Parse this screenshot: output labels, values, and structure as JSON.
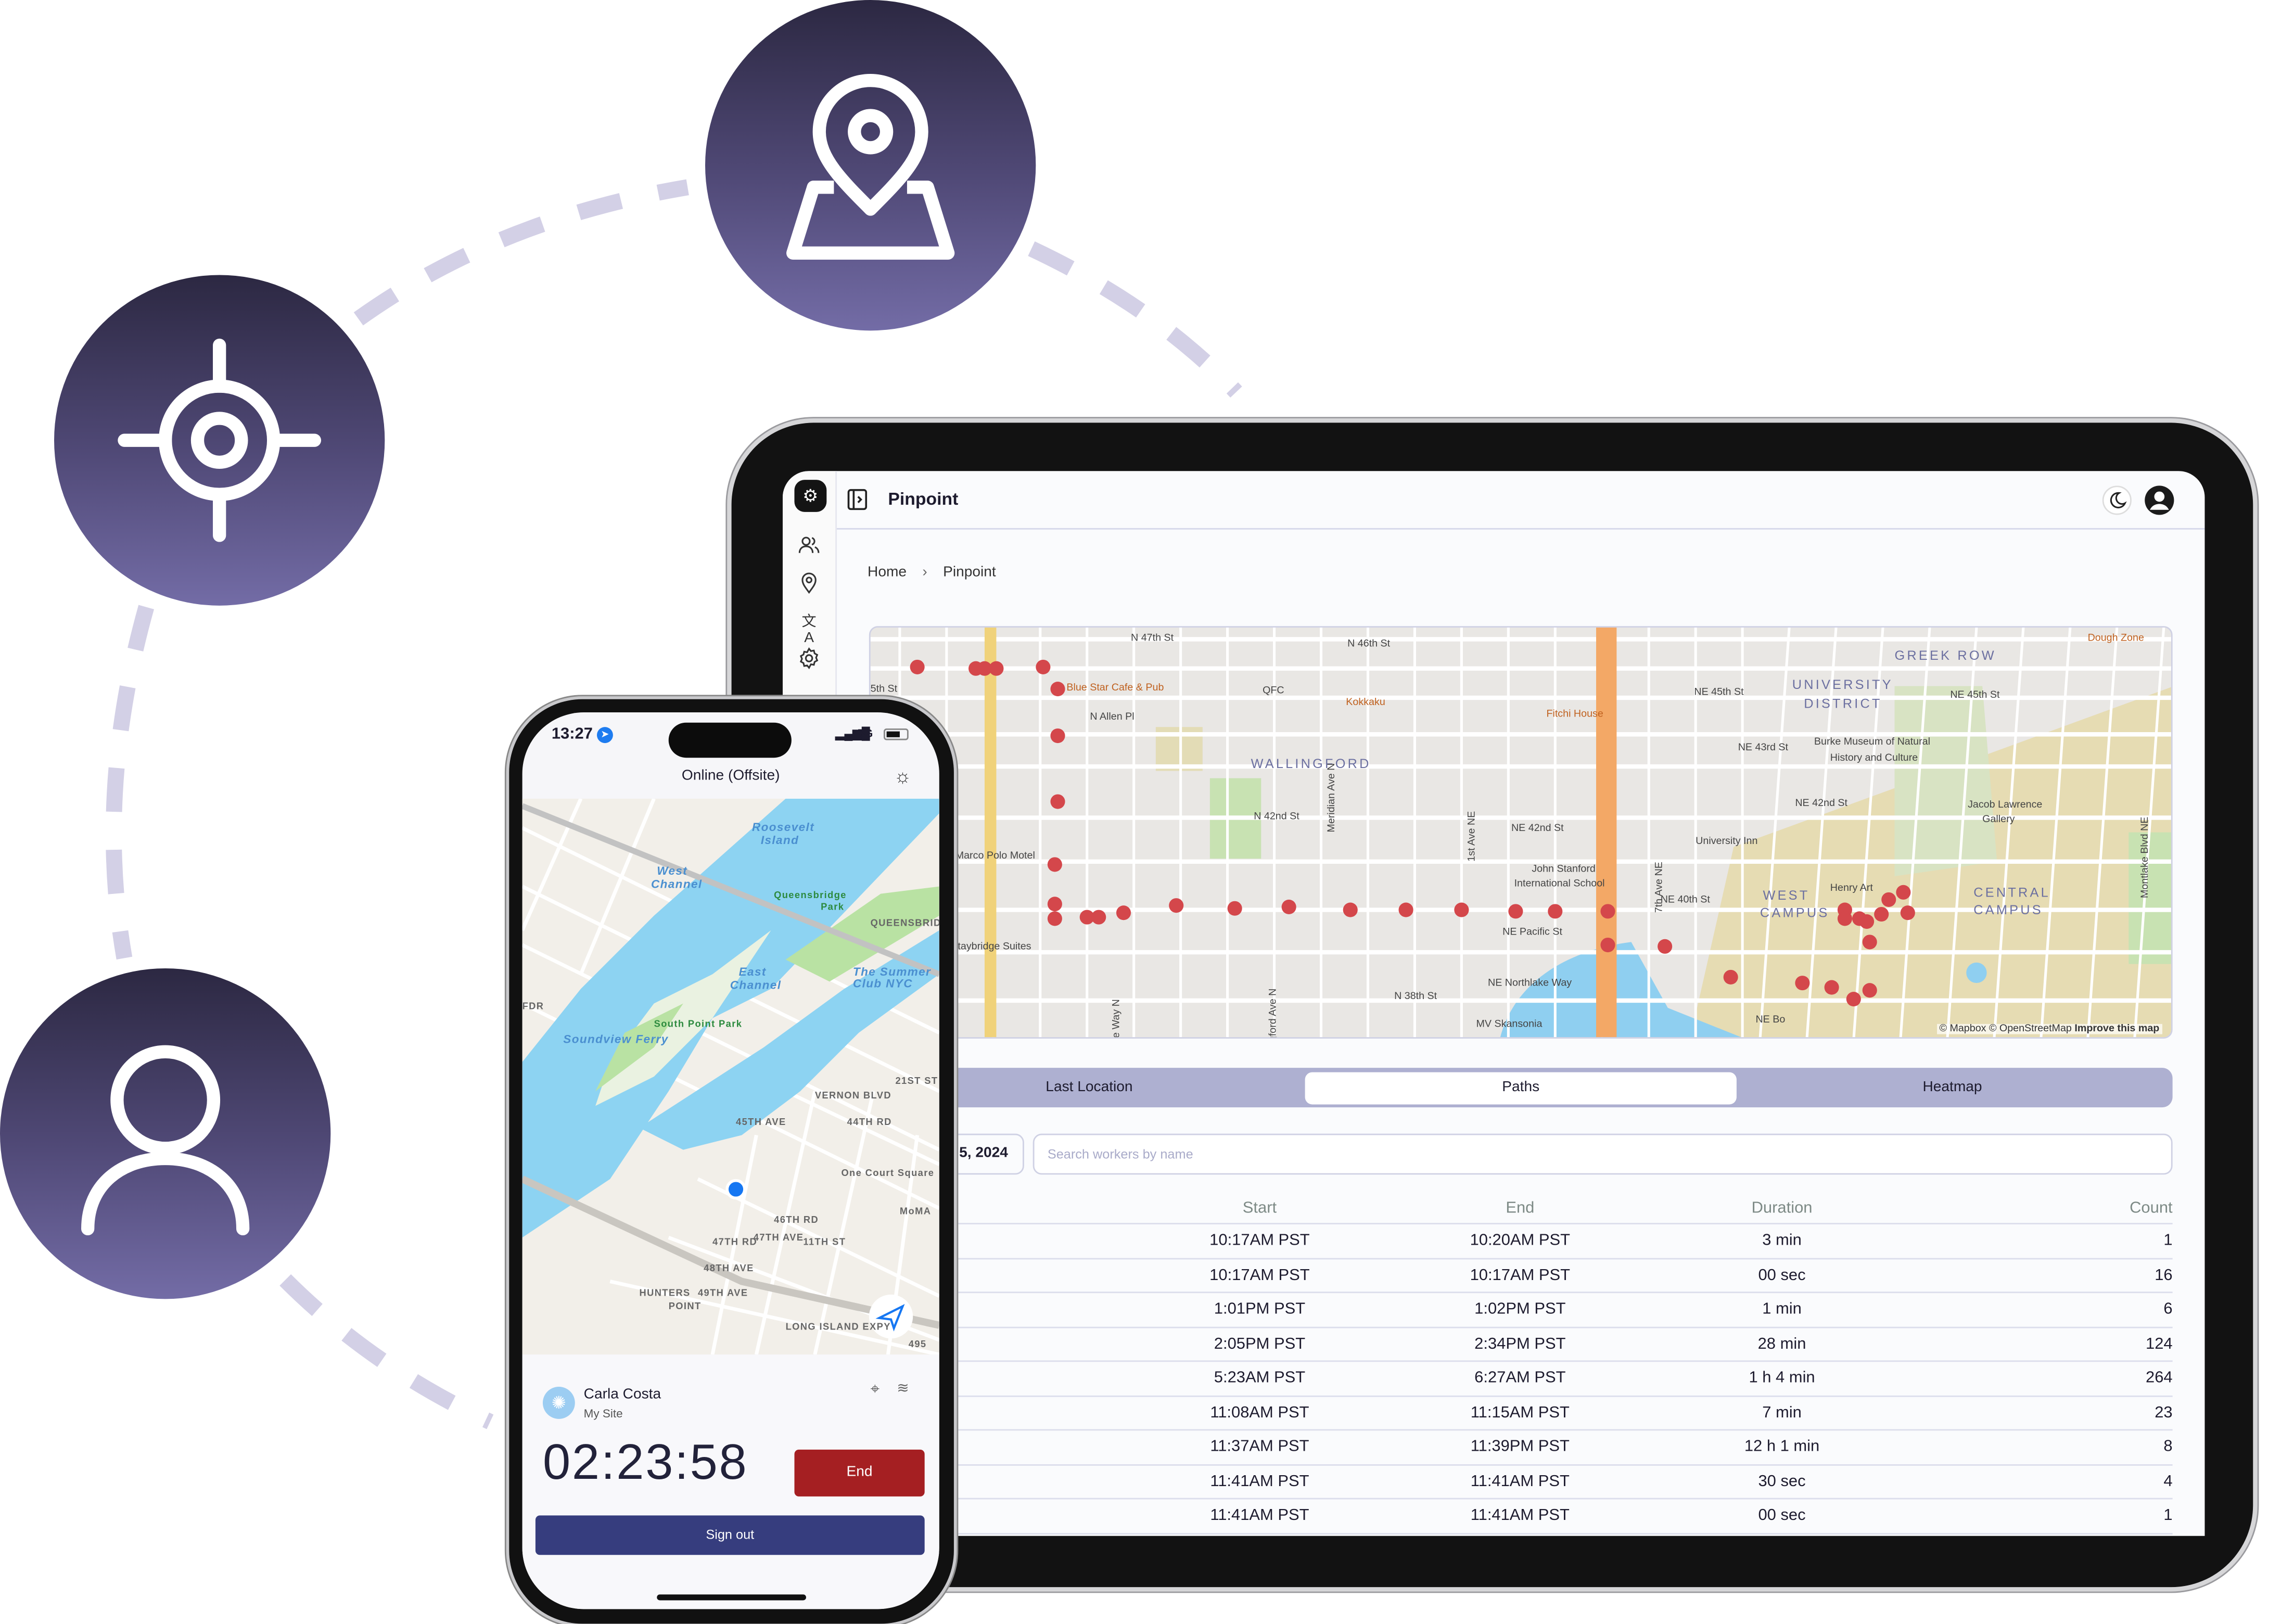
{
  "decor": {
    "circle_color_top": "#2c2842",
    "circle_color_bottom": "#736ca6",
    "dash_color": "#d3d0e6",
    "icons": [
      "map-pin-icon",
      "crosshair-icon",
      "user-icon"
    ]
  },
  "app": {
    "title": "Pinpoint",
    "breadcrumb": {
      "home": "Home",
      "separator": "›",
      "current": "Pinpoint"
    },
    "sidebar_icons": [
      "logo-icon",
      "users-icon",
      "location-icon",
      "translate-icon",
      "settings-icon"
    ],
    "header_icons": [
      "moon-icon",
      "account-icon"
    ],
    "map": {
      "labels": [
        "N 47th St",
        "N 46th St",
        "Blue Star Cafe & Pub",
        "QFC",
        "Kokkaku",
        "Fitchi House",
        "N Allen Pl",
        "WALLINGFORD",
        "N 42nd St",
        "NE 42nd St",
        "NE 45th St",
        "NE 45th St",
        "UNIVERSITY",
        "DISTRICT",
        "GREEK ROW",
        "Dough Zone",
        "NE 43rd St",
        "Burke Museum of Natural",
        "History and Culture",
        "NE 42nd St",
        "Jacob Lawrence",
        "Gallery",
        "University Inn",
        "John Stanford",
        "International School",
        "WEST",
        "CAMPUS",
        "CENTRAL",
        "CAMPUS",
        "Henry Art",
        "NE 40th St",
        "NE Pacific St",
        "NE Northlake Way",
        "N 38th St",
        "MV Skansonia",
        "Marco Polo Motel",
        "Staybridge Suites",
        "Meridian Ave N",
        "Wallingford Ave N",
        "Stone Way N",
        "1st Ave NE",
        "7th Ave NE",
        "Montlake Blvd NE",
        "NE Bo",
        "5th St"
      ],
      "attribution": "© Mapbox © OpenStreetMap",
      "improve": "Improve this map",
      "point_color": "#d4474b",
      "highway_color": "#f3a866"
    },
    "tabs": [
      {
        "label": "Last Location",
        "active": false
      },
      {
        "label": "Paths",
        "active": true
      },
      {
        "label": "Heatmap",
        "active": false
      }
    ],
    "date_value": "5, 2024",
    "search_placeholder": "Search workers by name",
    "table": {
      "headers": [
        "Start",
        "End",
        "Duration",
        "Count"
      ],
      "rows": [
        [
          "10:17AM PST",
          "10:20AM PST",
          "3 min",
          "1"
        ],
        [
          "10:17AM PST",
          "10:17AM PST",
          "00 sec",
          "16"
        ],
        [
          "1:01PM PST",
          "1:02PM PST",
          "1 min",
          "6"
        ],
        [
          "2:05PM PST",
          "2:34PM PST",
          "28 min",
          "124"
        ],
        [
          "5:23AM PST",
          "6:27AM PST",
          "1 h 4 min",
          "264"
        ],
        [
          "11:08AM PST",
          "11:15AM PST",
          "7 min",
          "23"
        ],
        [
          "11:37AM PST",
          "11:39PM PST",
          "12 h 1 min",
          "8"
        ],
        [
          "11:41AM PST",
          "11:41AM PST",
          "30 sec",
          "4"
        ],
        [
          "11:41AM PST",
          "11:41AM PST",
          "00 sec",
          "1"
        ]
      ]
    }
  },
  "phone": {
    "time": "13:27",
    "network": "5G",
    "status": "Online (Offsite)",
    "map_labels": [
      "Roosevelt",
      "Island",
      "West",
      "Channel",
      "Queensbridge",
      "Park",
      "QUEENSBRIDGE",
      "East",
      "Channel",
      "The Summer",
      "Club NYC",
      "South Point Park",
      "Soundview Ferry",
      "45TH AVE",
      "44TH RD",
      "One Court Square",
      "MoMA",
      "46TH RD",
      "47TH AVE",
      "47TH RD",
      "48TH AVE",
      "49TH AVE",
      "HUNTERS",
      "POINT",
      "LONG ISLAND EXPY",
      "495",
      "FDR",
      "11TH ST",
      "VERNON BLVD",
      "21ST ST"
    ],
    "user": {
      "name": "Carla Costa",
      "site": "My Site"
    },
    "timer": "02:23:58",
    "end_label": "End",
    "signout_label": "Sign out",
    "end_color": "#a51f22",
    "signout_color": "#363d7e"
  }
}
